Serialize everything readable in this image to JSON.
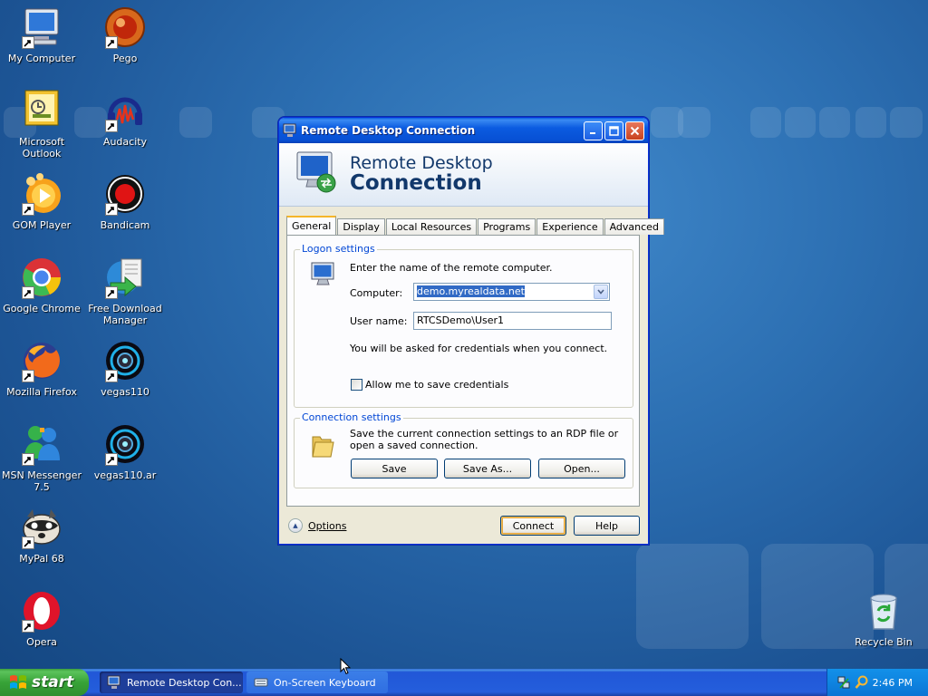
{
  "desktop": {
    "icons": [
      {
        "label": "My Computer",
        "icon": "my-computer-icon"
      },
      {
        "label": "Pego",
        "icon": "pego-icon"
      },
      {
        "label": "Microsoft Outlook",
        "icon": "outlook-icon"
      },
      {
        "label": "Audacity",
        "icon": "audacity-icon"
      },
      {
        "label": "GOM Player",
        "icon": "gom-player-icon"
      },
      {
        "label": "Bandicam",
        "icon": "bandicam-icon"
      },
      {
        "label": "Google Chrome",
        "icon": "chrome-icon"
      },
      {
        "label": "Free Download Manager",
        "icon": "fdm-icon"
      },
      {
        "label": "Mozilla Firefox",
        "icon": "firefox-icon"
      },
      {
        "label": "vegas110",
        "icon": "vegas-icon"
      },
      {
        "label": "MSN Messenger 7.5",
        "icon": "msn-icon"
      },
      {
        "label": "vegas110.ar",
        "icon": "vegas-icon"
      },
      {
        "label": "MyPal 68",
        "icon": "mypal-icon"
      },
      {
        "label": "Opera",
        "icon": "opera-icon"
      },
      {
        "label": "Recycle Bin",
        "icon": "recycle-bin-icon"
      }
    ]
  },
  "window": {
    "title": "Remote Desktop Connection",
    "banner_line1": "Remote Desktop",
    "banner_line2": "Connection",
    "tabs": [
      "General",
      "Display",
      "Local Resources",
      "Programs",
      "Experience",
      "Advanced"
    ],
    "active_tab": "General",
    "logon": {
      "legend": "Logon settings",
      "instruction": "Enter the name of the remote computer.",
      "computer_label": "Computer:",
      "computer_value": "demo.myrealdata.net",
      "username_label": "User name:",
      "username_value": "RTCSDemo\\User1",
      "credentials_note": "You will be asked for credentials when you connect.",
      "save_credentials_label": "Allow me to save credentials",
      "save_credentials_checked": false
    },
    "connection": {
      "legend": "Connection settings",
      "description": "Save the current connection settings to an RDP file or open a saved connection.",
      "save_label": "Save",
      "save_as_label": "Save As...",
      "open_label": "Open..."
    },
    "options_label": "Options",
    "connect_label": "Connect",
    "help_label": "Help"
  },
  "taskbar": {
    "start_label": "start",
    "tasks": [
      {
        "label": "Remote Desktop Con...",
        "active": true
      },
      {
        "label": "On-Screen Keyboard",
        "active": false
      }
    ],
    "clock": "2:46 PM"
  },
  "colors": {
    "desktop": "#2c6fb2",
    "titlebar": "#0b5be0",
    "dialog": "#ece9d8",
    "selection": "#316ac5",
    "groupbox_label": "#0046d5"
  }
}
